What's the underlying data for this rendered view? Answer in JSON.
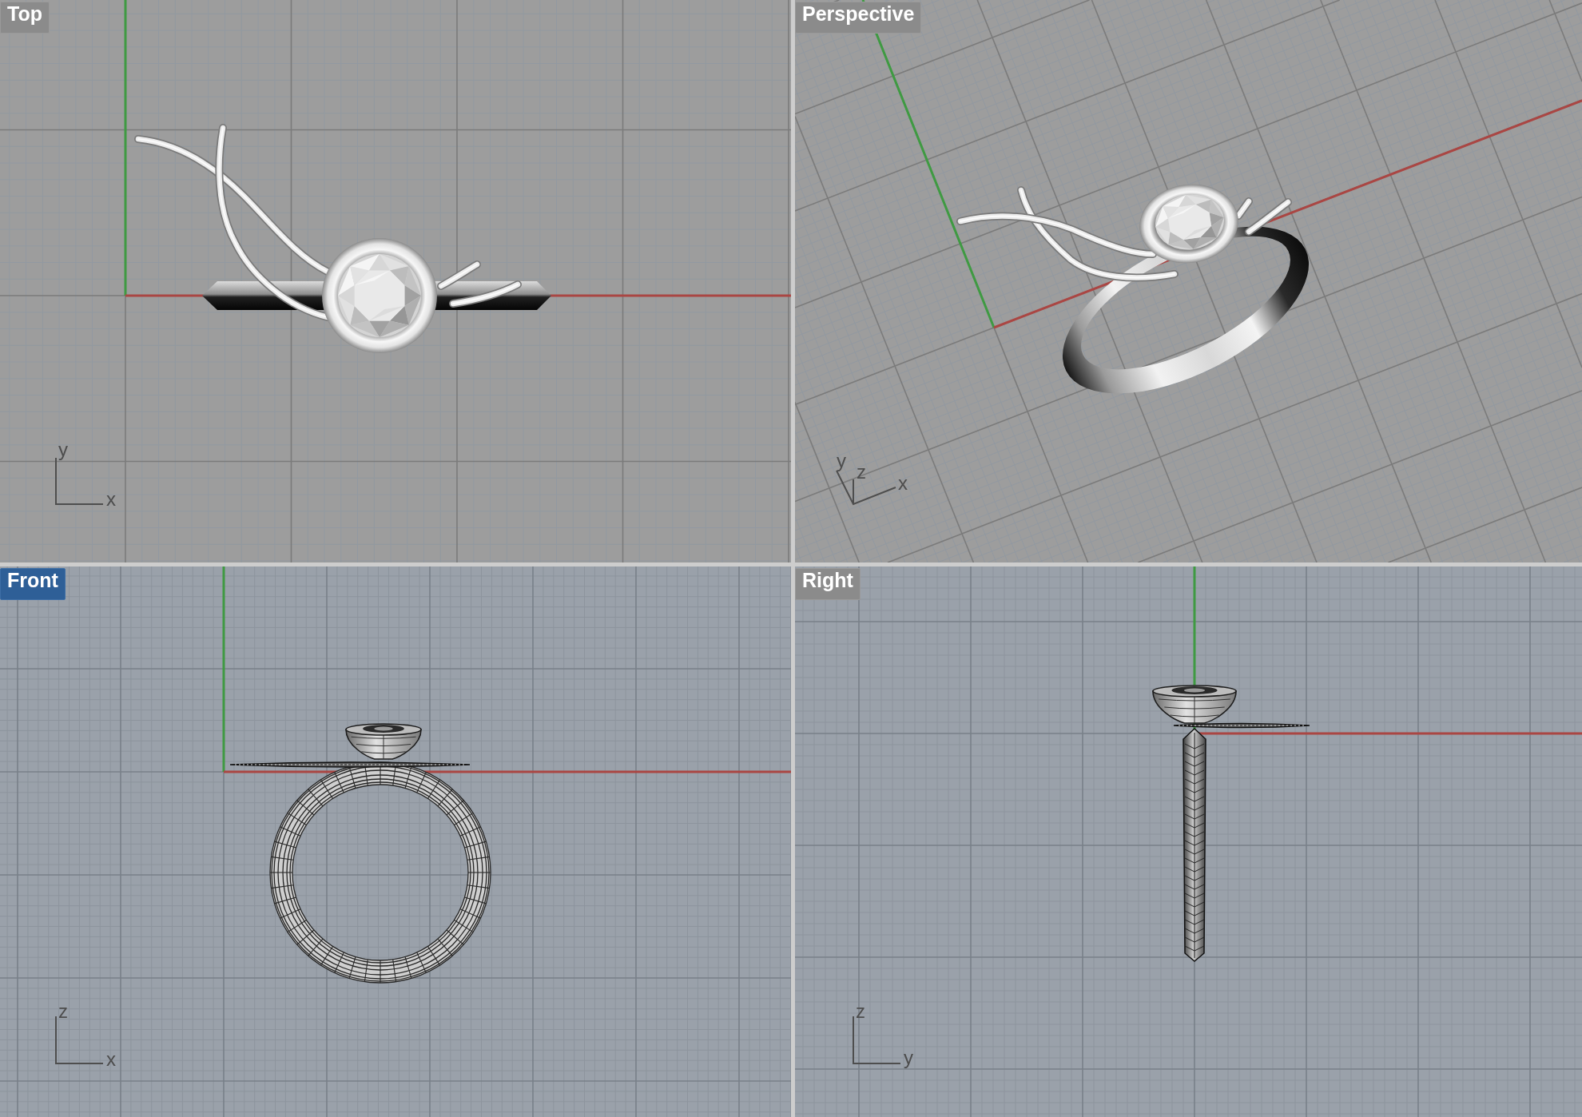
{
  "viewports": [
    {
      "kind": "top",
      "title": "Top",
      "selected": false,
      "axis_labels": [
        "y",
        "x"
      ]
    },
    {
      "kind": "perspective",
      "title": "Perspective",
      "selected": false,
      "axis_labels": [
        "y",
        "z",
        "x"
      ]
    },
    {
      "kind": "front",
      "title": "Front",
      "selected": true,
      "axis_labels": [
        "z",
        "x"
      ]
    },
    {
      "kind": "right",
      "title": "Right",
      "selected": false,
      "axis_labels": [
        "z",
        "y"
      ]
    }
  ]
}
